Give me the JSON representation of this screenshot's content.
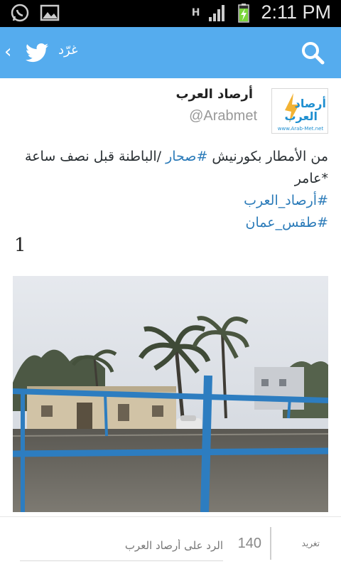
{
  "status_bar": {
    "time": "2:11 PM",
    "network_label": "H",
    "icons": [
      "whatsapp-icon",
      "gallery-icon",
      "signal-icon",
      "battery-charging-icon"
    ]
  },
  "app_bar": {
    "title": "غرّد",
    "icons": [
      "back-chevron-icon",
      "twitter-bird-icon",
      "search-icon"
    ],
    "background": "#55acee"
  },
  "author": {
    "name": "أرصاد العرب",
    "handle": "@Arabmet",
    "avatar_text": "أرصاد العرب",
    "avatar_sub": "www.Arab-Met.net"
  },
  "tweet": {
    "line1_pre": "من الأمطار بكورنيش ",
    "line1_tag": "#صحار",
    "line1_post": " /الباطنة قبل نصف ساعة",
    "line2": "*عامر",
    "hashtag1": "#أرصاد_العرب",
    "hashtag2": "#طقس_عمان",
    "number": "1",
    "link_color": "#2b7bb9"
  },
  "reply_bar": {
    "tweet_button": "تغريد",
    "char_count": "140",
    "placeholder": "الرد على أرصاد العرب"
  }
}
